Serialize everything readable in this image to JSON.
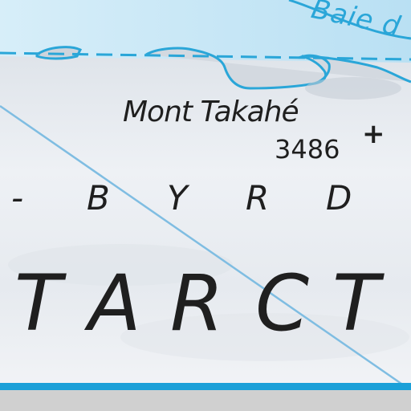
{
  "map": {
    "colors": {
      "water": "#bfe3f4",
      "coast": "#2aa6d8",
      "ice": "#e9edf2",
      "land_shade": "#cfd6de",
      "meridian": "#7fbde2",
      "frame_line": "#1ba0d8",
      "bottom_strip": "#d0d0d0"
    },
    "labels": {
      "bay": "Baie d",
      "peak_name": "Mont Takahé",
      "peak_elevation": "3486",
      "peak_symbol": "+",
      "region_letters": [
        "-",
        "B",
        "Y",
        "R",
        "D"
      ],
      "continent_letters": [
        "T",
        "A",
        "R",
        "C",
        "T"
      ]
    }
  }
}
